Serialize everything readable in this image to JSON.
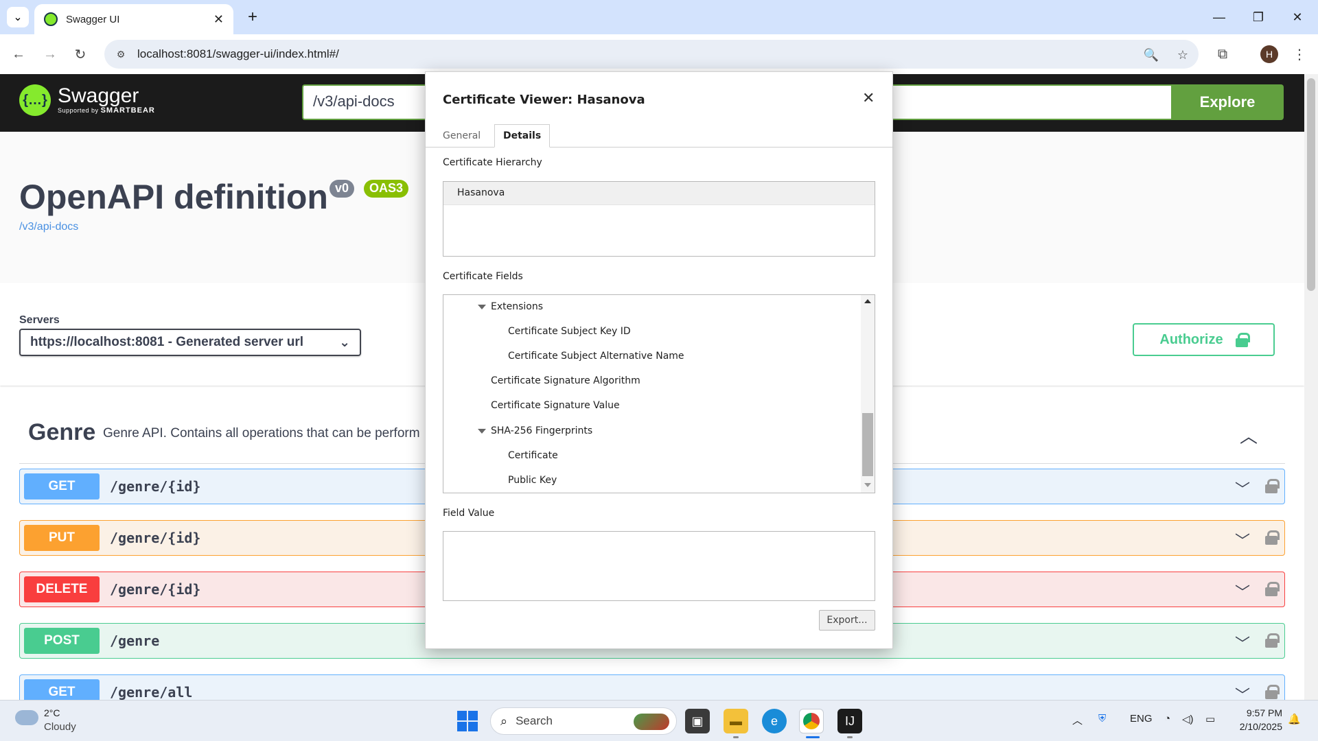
{
  "browser": {
    "tab_title": "Swagger UI",
    "url": "localhost:8081/swagger-ui/index.html#/",
    "profile_initial": "H"
  },
  "swagger": {
    "logo_name": "Swagger",
    "logo_sub_prefix": "Supported by",
    "logo_sub_brand": "SMARTBEAR",
    "spec_url": "/v3/api-docs",
    "explore_label": "Explore",
    "title": "OpenAPI definition",
    "version_badge": "v0",
    "oas_badge": "OAS3",
    "spec_link": "/v3/api-docs",
    "servers_label": "Servers",
    "server_selected": "https://localhost:8081 - Generated server url",
    "authorize_label": "Authorize",
    "tag_name": "Genre",
    "tag_description": "Genre API. Contains all operations that can be perform",
    "operations": [
      {
        "method": "GET",
        "path": "/genre/{id}",
        "color": "#61affe",
        "bg": "#ebf3fb"
      },
      {
        "method": "PUT",
        "path": "/genre/{id}",
        "color": "#fca130",
        "bg": "#fbf1e6"
      },
      {
        "method": "DELETE",
        "path": "/genre/{id}",
        "color": "#f93e3e",
        "bg": "#fae7e7"
      },
      {
        "method": "POST",
        "path": "/genre",
        "color": "#49cc90",
        "bg": "#e8f6f0"
      },
      {
        "method": "GET",
        "path": "/genre/all",
        "color": "#61affe",
        "bg": "#ebf3fb"
      }
    ]
  },
  "dialog": {
    "title": "Certificate Viewer: Hasanova",
    "tabs": [
      "General",
      "Details"
    ],
    "active_tab": "Details",
    "hierarchy_label": "Certificate Hierarchy",
    "hierarchy_items": [
      "Hasanova"
    ],
    "fields_label": "Certificate Fields",
    "fields": [
      {
        "label": "Extensions",
        "expanded": true
      },
      {
        "label": "Certificate Subject Key ID"
      },
      {
        "label": "Certificate Subject Alternative Name"
      },
      {
        "label": "Certificate Signature Algorithm"
      },
      {
        "label": "Certificate Signature Value"
      },
      {
        "label": "SHA-256 Fingerprints",
        "expanded": true
      },
      {
        "label": "Certificate"
      },
      {
        "label": "Public Key"
      }
    ],
    "field_value_label": "Field Value",
    "field_value": "",
    "export_label": "Export..."
  },
  "taskbar": {
    "weather_temp": "2°C",
    "weather_condition": "Cloudy",
    "search_placeholder": "Search",
    "language": "ENG",
    "time": "9:57 PM",
    "date": "2/10/2025"
  }
}
